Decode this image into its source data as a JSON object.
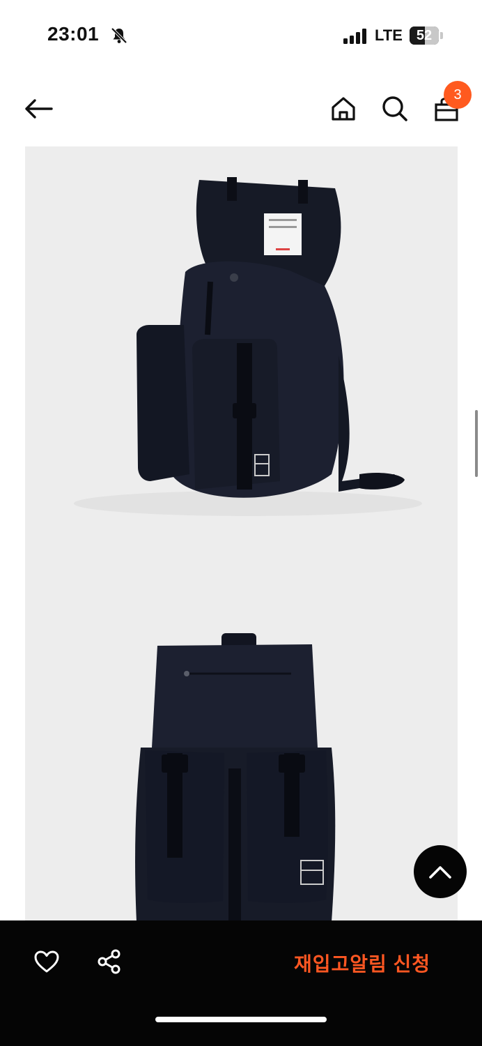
{
  "status_bar": {
    "time": "23:01",
    "network": "LTE",
    "battery_level": "52",
    "icons": [
      "bell-slash-icon",
      "signal-icon"
    ]
  },
  "nav": {
    "icons": [
      "arrow-left-icon",
      "home-icon",
      "search-icon",
      "shopping-bag-icon"
    ],
    "cart_count": "3",
    "badge_color": "#ff5a1f"
  },
  "product": {
    "images": [
      "backpack-open-flap-photo",
      "backpack-front-photo"
    ],
    "image_background": "#ededed"
  },
  "bottom_bar": {
    "icons": [
      "heart-icon",
      "share-icon"
    ],
    "restock_label": "재입고알림 신청",
    "accent_color": "#ff5722"
  },
  "scroll_top": {
    "icon": "chevron-up-icon"
  }
}
